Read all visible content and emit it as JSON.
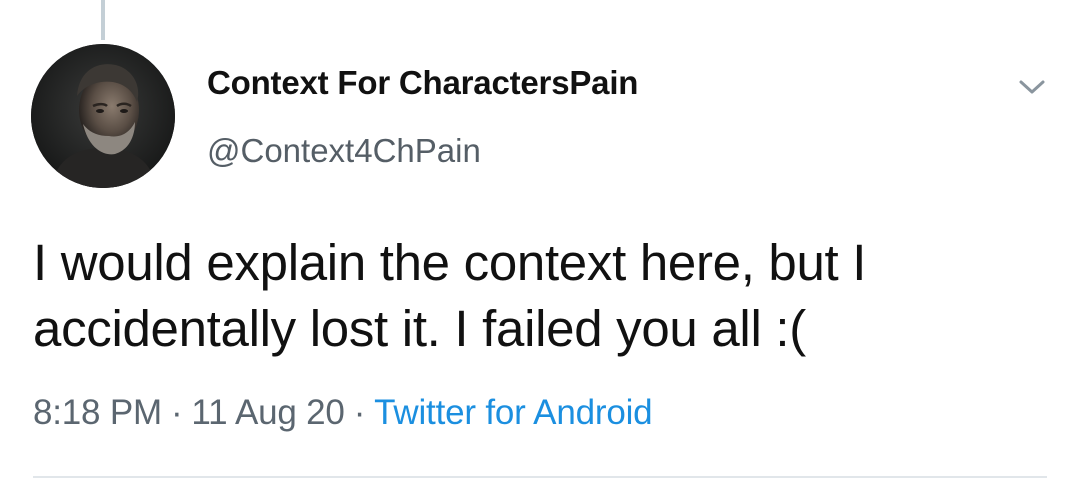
{
  "tweet": {
    "display_name": "Context For CharactersPain",
    "handle": "@Context4ChPain",
    "text_lines": [
      "I would explain the context here, but I",
      "accidentally lost it. I failed you all :("
    ],
    "time": "8:18 PM",
    "date": "11 Aug 20",
    "source": "Twitter for Android",
    "separator": "·"
  },
  "icons": {
    "menu": "chevron-down-icon"
  },
  "colors": {
    "link": "#1b8fe0",
    "secondary_text": "#5b6670",
    "thread_line": "#c4cfd6"
  }
}
